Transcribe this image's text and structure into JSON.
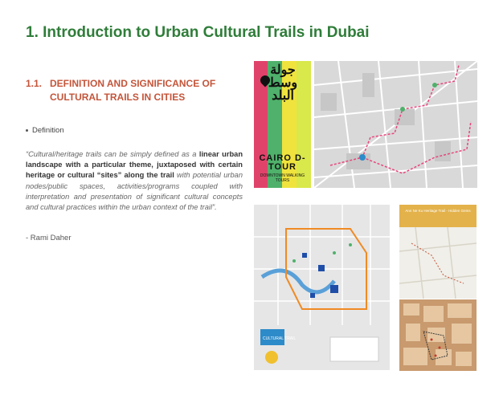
{
  "title": "1.  Introduction to Urban Cultural Trails in Dubai",
  "section": {
    "number": "1.1.",
    "heading": "DEFINITION AND SIGNIFICANCE OF CULTURAL TRAILS IN CITIES"
  },
  "bullet": "Definition",
  "quote": {
    "part1": "“Cultural/heritage trails can be simply defined as a ",
    "part2": "linear urban landscape with a particular theme, juxtaposed with certain heritage or cultural “sites” along the trail",
    "part3": " with potential urban nodes/public spaces, activities/programs coupled with interpretation and presentation of significant cultural concepts and cultural practices within the urban context of the trail”."
  },
  "author": "- Rami Daher",
  "poster": {
    "arabic": "جولة وسط البلد",
    "cairo": "CAIRO D-TOUR",
    "sub": "DOWNTOWN WALKING TOURS",
    "colors": [
      "#e0436a",
      "#4fb16b",
      "#f0e33d",
      "#d9e84a"
    ]
  },
  "downtown_map": {
    "logo": "CULTURAL TRAIL"
  },
  "brochure": {
    "header": "Ann Ne Ku Heritage Trail - Hidden Gems"
  }
}
